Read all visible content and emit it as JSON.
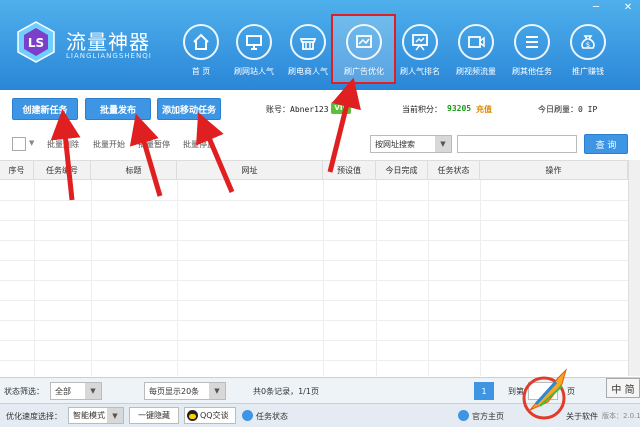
{
  "header": {
    "title": "流量神器",
    "subtitle": "LIANGLIANGSHENQI",
    "window_controls": [
      "─",
      "✕"
    ],
    "nav": [
      {
        "label": "首 页",
        "icon": "home-icon"
      },
      {
        "label": "刷网站人气",
        "icon": "monitor-icon"
      },
      {
        "label": "刷电商人气",
        "icon": "shop-icon"
      },
      {
        "label": "刷广告优化",
        "icon": "ad-icon"
      },
      {
        "label": "刷人气排名",
        "icon": "chart-board-icon"
      },
      {
        "label": "刷视频流量",
        "icon": "video-icon"
      },
      {
        "label": "刷其他任务",
        "icon": "list-icon"
      },
      {
        "label": "推广赚钱",
        "icon": "money-bag-icon"
      }
    ]
  },
  "toolbar": {
    "create_task": "创建新任务",
    "batch_publish": "批量发布",
    "add_mobile_task": "添加移动任务",
    "account_label": "账号：Abner123",
    "vip_badge": "VIP",
    "points_label": "当前积分：",
    "points_value": "93205",
    "recharge": "充值",
    "today_label": "今日刷量：0 IP"
  },
  "batch_bar": {
    "batch_delete": "批量删除",
    "batch_start": "批量开始",
    "batch_pause": "批量暂停",
    "batch_stop": "批量停止",
    "search_mode": "按网址搜索",
    "search_placeholder": "",
    "query": "查 询"
  },
  "table": {
    "columns": [
      "序号",
      "任务编号",
      "标题",
      "网址",
      "预设值",
      "今日完成",
      "任务状态",
      "操作"
    ]
  },
  "footer": {
    "status_filter_label": "状态筛选：",
    "status_filter_value": "全部",
    "per_page": "每页显示20条",
    "records": "共0条记录，1/1页",
    "current_page": "1",
    "goto": "到第",
    "page_unit": "页",
    "ime": "中 简",
    "speed_label": "优化速度选择：",
    "speed_mode": "智能模式",
    "hide": "一键隐藏",
    "qq_chat": "QQ交谈",
    "task_status": "任务状态",
    "official_site": "官方主页",
    "about": "关于软件",
    "version": "版本：2.0.1.0"
  },
  "colors": {
    "header_top": "#4fb0ec",
    "header_bottom": "#2a86d8",
    "button": "#3d95e4",
    "highlight": "#e02020",
    "points": "#1a9a1a",
    "recharge": "#e08a00"
  }
}
